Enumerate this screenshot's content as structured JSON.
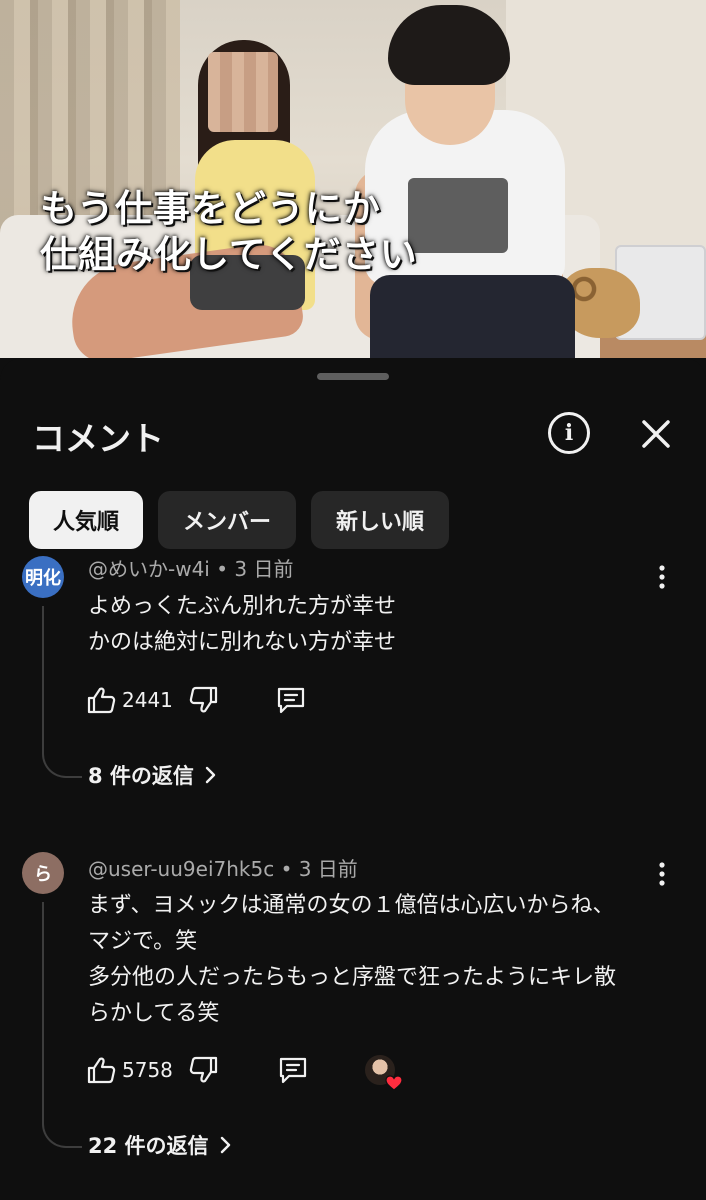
{
  "video": {
    "caption_line1": "もう仕事をどうにか",
    "caption_line2": "仕組み化してください"
  },
  "sheet": {
    "title": "コメント",
    "info_icon": "info-icon",
    "close_icon": "close-icon"
  },
  "filters": [
    {
      "label": "人気順",
      "active": true
    },
    {
      "label": "メンバー",
      "active": false
    },
    {
      "label": "新しい順",
      "active": false
    }
  ],
  "comments": [
    {
      "avatar_text": "明化",
      "avatar_color": "#3a6fc2",
      "author": "@めいか-w4i",
      "separator": "•",
      "time": "3 日前",
      "lines": [
        "よめっくたぶん別れた方が幸せ",
        "かのは絶対に別れない方が幸せ"
      ],
      "likes": "2441",
      "replies_label": "8 件の返信"
    },
    {
      "avatar_text": "ら",
      "avatar_color": "#8d6e63",
      "author": "@user-uu9ei7hk5c",
      "separator": "•",
      "time": "3 日前",
      "lines": [
        "まず、ヨメックは通常の女の１億倍は心広いからね、",
        "マジで。笑",
        "多分他の人だったらもっと序盤で狂ったようにキレ散",
        "らかしてる笑"
      ],
      "likes": "5758",
      "creator_heart": true,
      "replies_label": "22 件の返信"
    }
  ]
}
